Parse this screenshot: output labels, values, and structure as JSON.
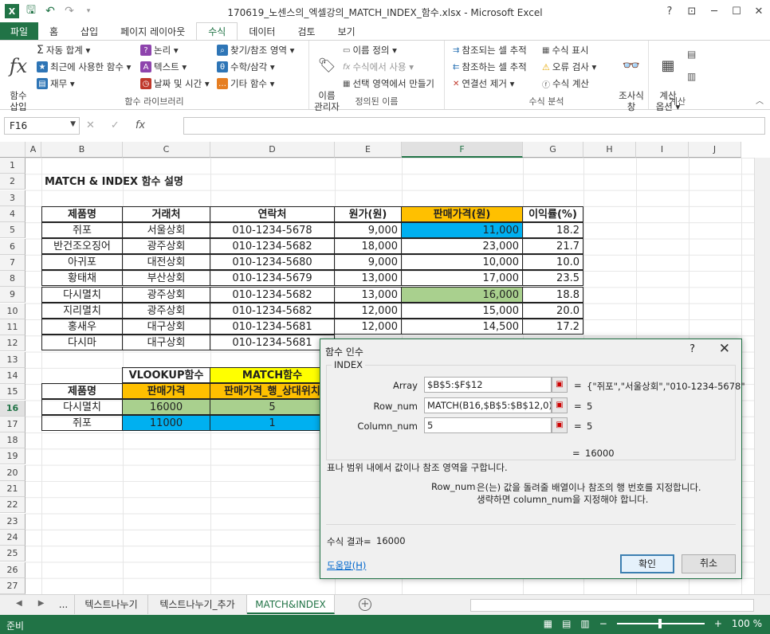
{
  "app": {
    "title": "170619_노센스의_엑셀강의_MATCH_INDEX_함수.xlsx - Microsoft Excel",
    "win_help": "?",
    "win_min": "─",
    "win_max": "☐",
    "win_close": "✕"
  },
  "tabs": [
    "파일",
    "홈",
    "삽입",
    "페이지 레이아웃",
    "수식",
    "데이터",
    "검토",
    "보기"
  ],
  "ribbon": {
    "insert_fn": "함수\n삽입",
    "library": {
      "autosum": "자동 합계 ▾",
      "recent": "최근에 사용한 함수 ▾",
      "finance": "재무 ▾",
      "logic": "논리 ▾",
      "text": "텍스트 ▾",
      "datetime": "날짜 및 시간 ▾",
      "lookup": "찾기/참조 영역 ▾",
      "math": "수학/삼각 ▾",
      "more": "기타 함수 ▾",
      "label": "함수 라이브러리"
    },
    "names": {
      "manager": "이름\n관리자",
      "define": "이름 정의 ▾",
      "use_in_formula": "수식에서 사용 ▾",
      "create_from_sel": "선택 영역에서 만들기",
      "label": "정의된 이름"
    },
    "audit": {
      "trace_prec": "참조되는 셀 추적",
      "trace_dep": "참조하는 셀 추적",
      "remove_arrows": "연결선 제거 ▾",
      "show_formulas": "수식 표시",
      "error_check": "오류 검사 ▾",
      "evaluate": "수식 계산",
      "watch": "조사식\n창",
      "label": "수식 분석"
    },
    "calc": {
      "options": "계산\n옵션 ▾",
      "label": "계산"
    }
  },
  "formula_bar": {
    "name_box": "F16",
    "fx": "fx",
    "cancel": "✕",
    "enter": "✓",
    "content": ""
  },
  "columns": [
    "A",
    "B",
    "C",
    "D",
    "E",
    "F",
    "G",
    "H",
    "I",
    "J"
  ],
  "rows": [
    "1",
    "2",
    "3",
    "4",
    "5",
    "6",
    "7",
    "8",
    "9",
    "10",
    "11",
    "12",
    "13",
    "14",
    "15",
    "16",
    "17",
    "18",
    "19",
    "20",
    "21",
    "22",
    "23",
    "24",
    "25",
    "26",
    "27"
  ],
  "sheet": {
    "heading": "MATCH & INDEX 함수 설명",
    "headers": [
      "제품명",
      "거래처",
      "연락처",
      "원가(원)",
      "판매가격(원)",
      "이익률(%)"
    ],
    "data": [
      [
        "쥐포",
        "서울상회",
        "010-1234-5678",
        "9,000",
        "11,000",
        "18.2"
      ],
      [
        "반건조오징어",
        "광주상회",
        "010-1234-5682",
        "18,000",
        "23,000",
        "21.7"
      ],
      [
        "아귀포",
        "대전상회",
        "010-1234-5680",
        "9,000",
        "10,000",
        "10.0"
      ],
      [
        "황태채",
        "부산상회",
        "010-1234-5679",
        "13,000",
        "17,000",
        "23.5"
      ],
      [
        "다시멸치",
        "광주상회",
        "010-1234-5682",
        "13,000",
        "16,000",
        "18.8"
      ],
      [
        "지리멸치",
        "광주상회",
        "010-1234-5682",
        "12,000",
        "15,000",
        "20.0"
      ],
      [
        "홍새우",
        "대구상회",
        "010-1234-5681",
        "12,000",
        "14,500",
        "17.2"
      ],
      [
        "다시마",
        "대구상회",
        "010-1234-5681",
        "",
        "",
        ""
      ]
    ],
    "lookup": {
      "vlookup_hdr": "VLOOKUP함수",
      "match_hdr": "MATCH함수",
      "col_name": "제품명",
      "col_price": "판매가격",
      "col_rel": "판매가격_행_상대위치",
      "rows": [
        [
          "다시멸치",
          "16000",
          "5"
        ],
        [
          "쥐포",
          "11000",
          "1"
        ]
      ]
    }
  },
  "dialog": {
    "title": "함수 인수",
    "help": "?",
    "close": "✕",
    "fn_name": "INDEX",
    "args": [
      {
        "label": "Array",
        "value": "$B$5:$F$12",
        "result": "{\"쥐포\",\"서울상회\",\"010-1234-5678\""
      },
      {
        "label": "Row_num",
        "value": "MATCH(B16,$B$5:$B$12,0)",
        "result": "5"
      },
      {
        "label": "Column_num",
        "value": "5",
        "result": "5"
      }
    ],
    "eq": "=",
    "overall_result": "16000",
    "description": "표나 범위 내에서 값이나 참조 영역을 구합니다.",
    "arg_name": "Row_num",
    "arg_desc1": "은(는) 값을 돌려줄 배열이나 참조의 행 번호를 지정합니다.",
    "arg_desc2": "생략하면 column_num을 지정해야 합니다.",
    "formula_result_label": "수식 결과=",
    "formula_result": "16000",
    "help_link": "도움말(H)",
    "ok": "확인",
    "cancel": "취소"
  },
  "sheet_tabs": {
    "more": "...",
    "tabs": [
      "텍스트나누기",
      "텍스트나누기_추가",
      "MATCH&INDEX"
    ],
    "add": "+"
  },
  "status": {
    "ready": "준비",
    "zoom": "100 %"
  },
  "colors": {
    "excel_green": "#217346",
    "header_orange": "#ffc000",
    "highlight_blue": "#00b0f0",
    "highlight_green": "#a9d08e",
    "match_yellow": "#ffff00"
  }
}
